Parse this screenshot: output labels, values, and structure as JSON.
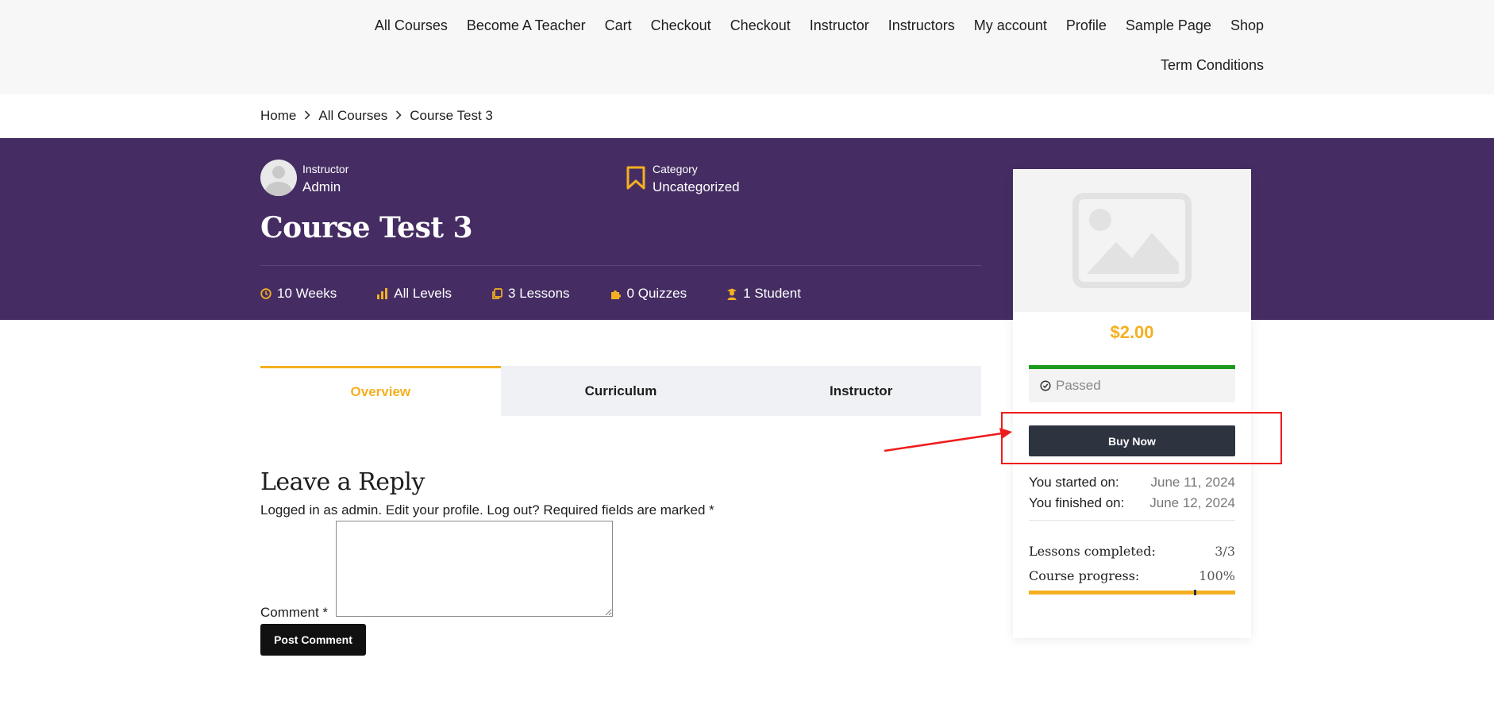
{
  "nav": {
    "row1": [
      "All Courses",
      "Become A Teacher",
      "Cart",
      "Checkout",
      "Checkout",
      "Instructor",
      "Instructors",
      "My account",
      "Profile",
      "Sample Page",
      "Shop"
    ],
    "row2": [
      "Term Conditions"
    ]
  },
  "breadcrumb": {
    "home": "Home",
    "parent": "All Courses",
    "current": "Course Test 3",
    "separator": ">"
  },
  "hero": {
    "instructor_label": "Instructor",
    "instructor_name": "Admin",
    "category_label": "Category",
    "category_value": "Uncategorized",
    "title": "Course Test 3",
    "stats": {
      "duration": "10 Weeks",
      "level": "All Levels",
      "lessons": "3 Lessons",
      "quizzes": "0 Quizzes",
      "students": "1 Student"
    }
  },
  "tabs": {
    "overview": "Overview",
    "curriculum": "Curriculum",
    "instructor": "Instructor"
  },
  "reply": {
    "title": "Leave a Reply",
    "logged_in_as": "Logged in as admin.",
    "edit_profile": "Edit your profile.",
    "log_out": "Log out?",
    "required_note": "Required fields are marked *",
    "comment_label": "Comment *",
    "post_button": "Post Comment"
  },
  "card": {
    "price": "$2.00",
    "status": "Passed",
    "buy_button": "Buy Now",
    "started_label": "You started on:",
    "started_value": "June 11, 2024",
    "finished_label": "You finished on:",
    "finished_value": "June 12, 2024",
    "lessons_completed_label": "Lessons completed:",
    "lessons_completed_value": "3/3",
    "course_progress_label": "Course progress:",
    "course_progress_value": "100%",
    "progress_fraction": 1.0
  },
  "colors": {
    "hero_bg": "#452d63",
    "accent": "#f4b020",
    "passed": "#1d9a1d",
    "buy_button": "#2e3340",
    "annotation": "#ee1c1c"
  }
}
